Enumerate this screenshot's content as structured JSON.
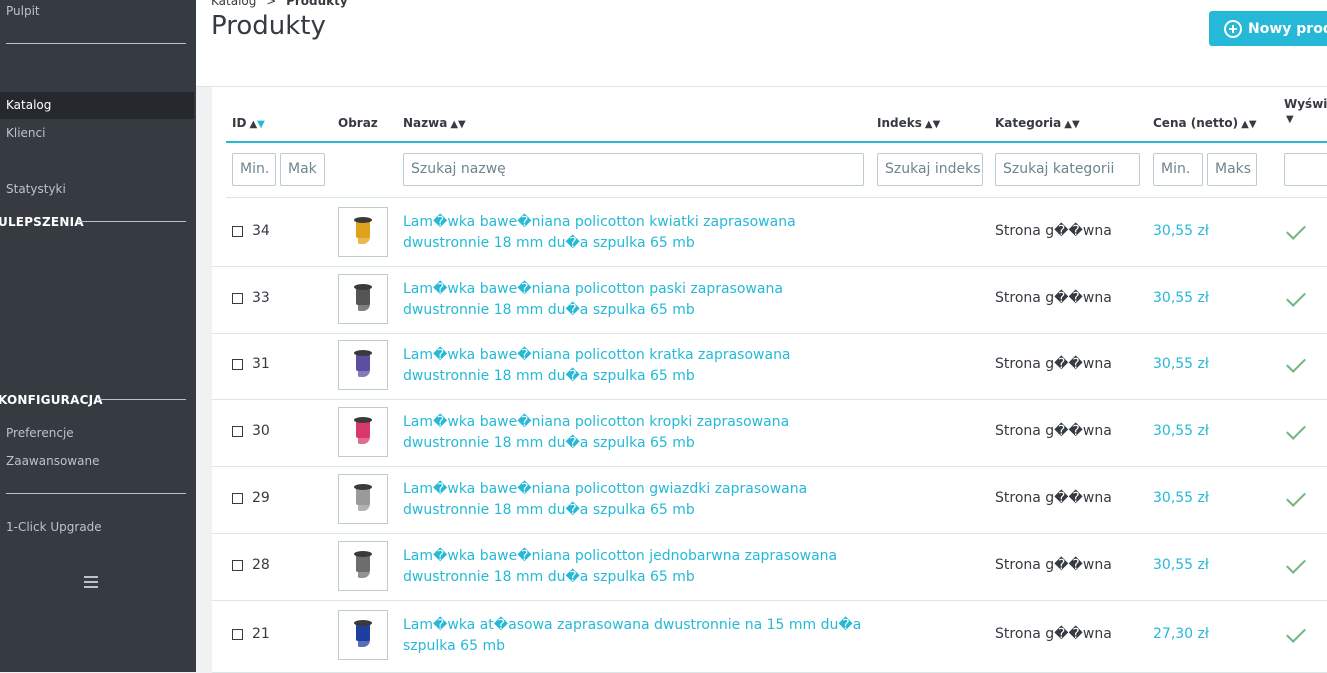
{
  "sidebar": {
    "items_top": [
      {
        "label": "Pulpit"
      }
    ],
    "active_item": "Katalog",
    "items": [
      {
        "label": "Klienci"
      },
      {
        "label": "Statystyki"
      }
    ],
    "section_ulepszenia": "ULEPSZENIA",
    "section_konfiguracja": "KONFIGURACJA",
    "config_items": [
      {
        "label": "Preferencje"
      },
      {
        "label": "Zaawansowane"
      }
    ],
    "upgrade_item": "1-Click Upgrade"
  },
  "header": {
    "breadcrumb_parent": "Katalog",
    "breadcrumb_sep": ">",
    "breadcrumb_current": "Produkty",
    "title": "Produkty",
    "new_button": "Nowy produ"
  },
  "table": {
    "columns": {
      "id": "ID",
      "image": "Obraz",
      "name": "Nazwa",
      "index": "Indeks",
      "category": "Kategoria",
      "price": "Cena (netto)",
      "display": "Wyświe"
    },
    "sort_up": "▲",
    "sort_down": "▼",
    "filters": {
      "id_min": "Min.",
      "id_max": "Mak",
      "name": "Szukaj nazwę",
      "index": "Szukaj indeks",
      "category": "Szukaj kategorii",
      "price_min": "Min.",
      "price_max": "Maks"
    },
    "rows": [
      {
        "id": "34",
        "name": "Lam�wka bawe�niana policotton kwiatki zaprasowana dwustronnie 18 mm du�a szpulka 65 mb",
        "category": "Strona g��wna",
        "price": "30,55 zł",
        "color": "#e0a21a"
      },
      {
        "id": "33",
        "name": "Lam�wka bawe�niana policotton paski zaprasowana dwustronnie 18 mm du�a szpulka 65 mb",
        "category": "Strona g��wna",
        "price": "30,55 zł",
        "color": "#555555"
      },
      {
        "id": "31",
        "name": "Lam�wka bawe�niana policotton kratka zaprasowana dwustronnie 18 mm du�a szpulka 65 mb",
        "category": "Strona g��wna",
        "price": "30,55 zł",
        "color": "#5a4fa0"
      },
      {
        "id": "30",
        "name": "Lam�wka bawe�niana policotton kropki zaprasowana dwustronnie 18 mm du�a szpulka 65 mb",
        "category": "Strona g��wna",
        "price": "30,55 zł",
        "color": "#d9386a"
      },
      {
        "id": "29",
        "name": "Lam�wka bawe�niana policotton gwiazdki zaprasowana dwustronnie 18 mm du�a szpulka 65 mb",
        "category": "Strona g��wna",
        "price": "30,55 zł",
        "color": "#9a9a9a"
      },
      {
        "id": "28",
        "name": "Lam�wka bawe�niana policotton jednobarwna zaprasowana dwustronnie 18 mm du�a szpulka 65 mb",
        "category": "Strona g��wna",
        "price": "30,55 zł",
        "color": "#6d6d6d"
      },
      {
        "id": "21",
        "name": "Lam�wka at�asowa zaprasowana dwustronnie na 15 mm du�a szpulka 65 mb",
        "category": "Strona g��wna",
        "price": "27,30 zł",
        "color": "#1f3fa0"
      }
    ]
  },
  "colors": {
    "accent": "#25b9d7",
    "sidebar_bg": "#363a41",
    "success": "#70b580"
  }
}
